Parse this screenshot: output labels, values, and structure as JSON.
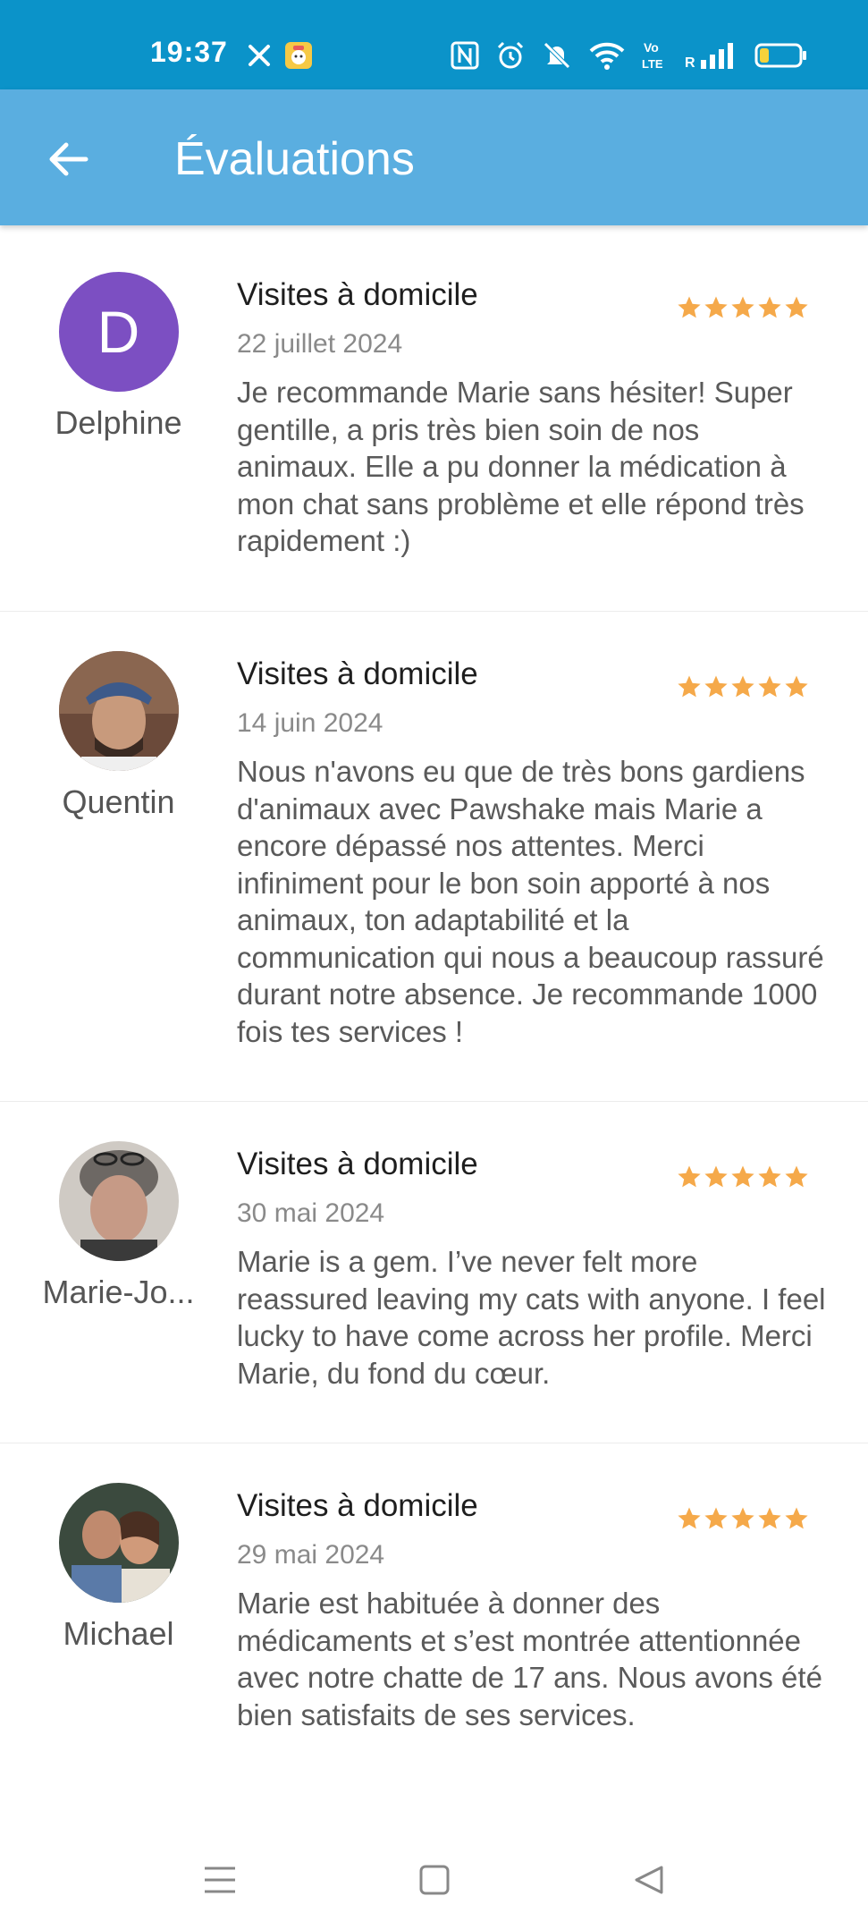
{
  "status_bar": {
    "time": "19:37",
    "icons": [
      "cross-app-icon",
      "notification-app-icon",
      "nfc-icon",
      "alarm-icon",
      "mute-icon",
      "wifi-icon",
      "volte-icon",
      "signal-icon",
      "battery-icon"
    ],
    "volte_label": "Vo\nLTE",
    "roaming_label": "R"
  },
  "app_bar": {
    "title": "Évaluations",
    "back_icon": "arrow-left-icon"
  },
  "colors": {
    "status_bar": "#0b93c9",
    "app_bar": "#5aaee0",
    "star": "#f5a94a",
    "avatar_letter_bg": "#7c4fc2"
  },
  "reviews": [
    {
      "reviewer": "Delphine",
      "avatar_letter": "D",
      "service": "Visites à domicile",
      "date": "22 juillet 2024",
      "rating": 5,
      "text": "Je recommande Marie sans hésiter! Super gentille, a pris très bien soin de nos animaux. Elle a pu donner la médication à mon chat sans problème et elle répond très rapidement :)"
    },
    {
      "reviewer": "Quentin",
      "service": "Visites à domicile",
      "date": "14 juin 2024",
      "rating": 5,
      "text": "Nous n'avons eu que de très bons gardiens d'animaux avec Pawshake mais Marie a encore dépassé nos attentes. Merci infiniment pour le bon soin apporté à nos animaux, ton adaptabilité et la communication qui nous a beaucoup rassuré durant notre absence. Je recommande 1000 fois tes services !"
    },
    {
      "reviewer": "Marie-Jo...",
      "service": "Visites à domicile",
      "date": "30 mai 2024",
      "rating": 5,
      "text": "Marie is a gem. I’ve never felt more reassured leaving my cats with anyone. I feel lucky to have come across her profile. Merci Marie, du fond du cœur."
    },
    {
      "reviewer": "Michael",
      "service": "Visites à domicile",
      "date": "29 mai 2024",
      "rating": 5,
      "text": "Marie est habituée à donner des médicaments et s’est montrée attentionnée avec notre chatte de 17 ans. Nous avons été bien satisfaits de ses services."
    }
  ],
  "nav_bar": {
    "icons": [
      "menu-icon",
      "home-square-icon",
      "back-triangle-icon"
    ]
  }
}
